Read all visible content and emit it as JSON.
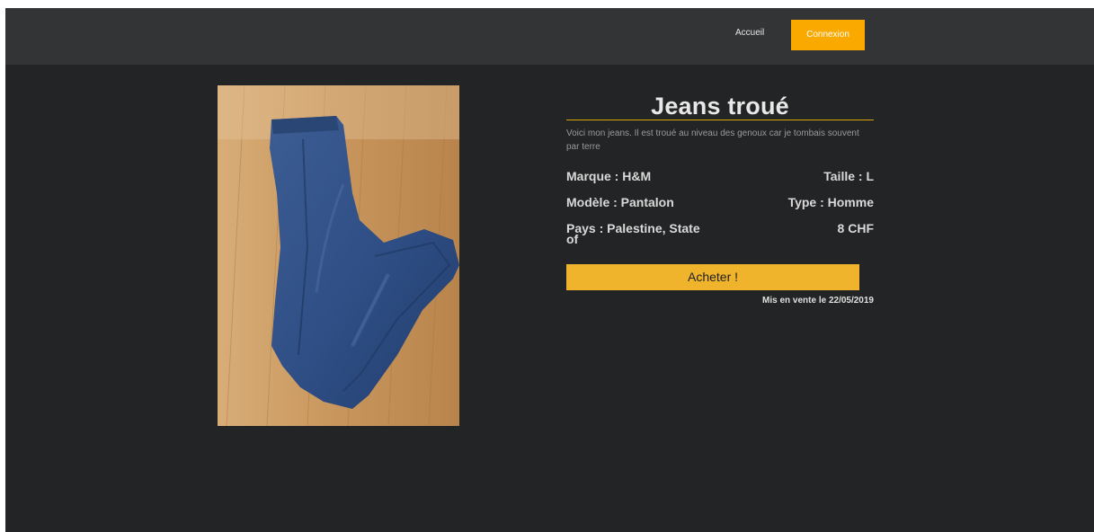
{
  "nav": {
    "home_label": "Accueil",
    "login_label": "Connexion",
    "accent_color": "#f9a900"
  },
  "product": {
    "title": "Jeans troué",
    "description": "Voici mon jeans. Il est troué au niveau des genoux car je tombais souvent par terre",
    "brand": "Marque : H&M",
    "size": "Taille : L",
    "model": "Modèle : Pantalon",
    "type": "Type : Homme",
    "country": "Pays : Palestine, State of",
    "price": "8 CHF",
    "buy_label": "Acheter !",
    "listed_date": "Mis en vente le 22/05/2019",
    "image_icon": "jeans-photo"
  }
}
